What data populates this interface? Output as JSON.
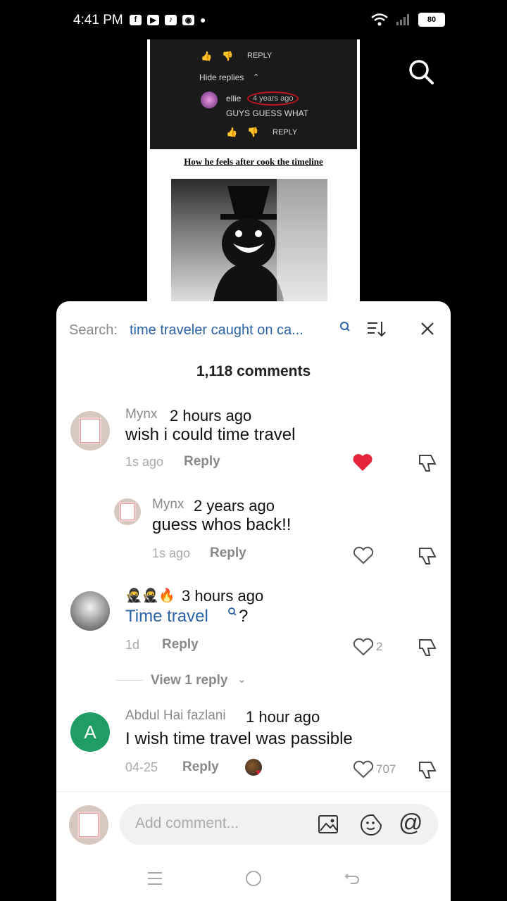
{
  "status_bar": {
    "time": "4:41 PM",
    "battery": "80"
  },
  "video": {
    "reply_label_top": "REPLY",
    "hide_replies": "Hide replies",
    "reply_user": "ellie",
    "reply_time": "4 years ago",
    "reply_text": "GUYS GUESS WHAT",
    "reply_label_bottom": "REPLY",
    "caption": "How he feels after cook the timeline"
  },
  "sheet": {
    "search_label": "Search:",
    "search_query": "time traveler caught on ca...",
    "comment_count": "1,118 comments",
    "comments": [
      {
        "name": "Mynx",
        "stamp": "2 hours ago",
        "text": "wish i could time travel",
        "age": "1s ago",
        "reply": "Reply"
      },
      {
        "name": "Mynx",
        "stamp": "2 years ago",
        "text": "guess whos back!!",
        "age": "1s ago",
        "reply": "Reply"
      },
      {
        "name": "🥷🥷🔥",
        "stamp": "3 hours ago",
        "text_link": "Time travel",
        "text_suffix": "?",
        "age": "1d",
        "reply": "Reply",
        "likes": "2",
        "view_replies": "View 1 reply"
      },
      {
        "name": "Abdul Hai fazlani",
        "stamp": "1 hour ago",
        "text": "I wish time travel was passible",
        "age": "04-25",
        "reply": "Reply",
        "likes": "707",
        "avatar_letter": "A"
      }
    ],
    "input_placeholder": "Add comment..."
  },
  "colors": {
    "link": "#2b63a6",
    "liked": "#e5263a",
    "avatar_green": "#1e9e62"
  }
}
